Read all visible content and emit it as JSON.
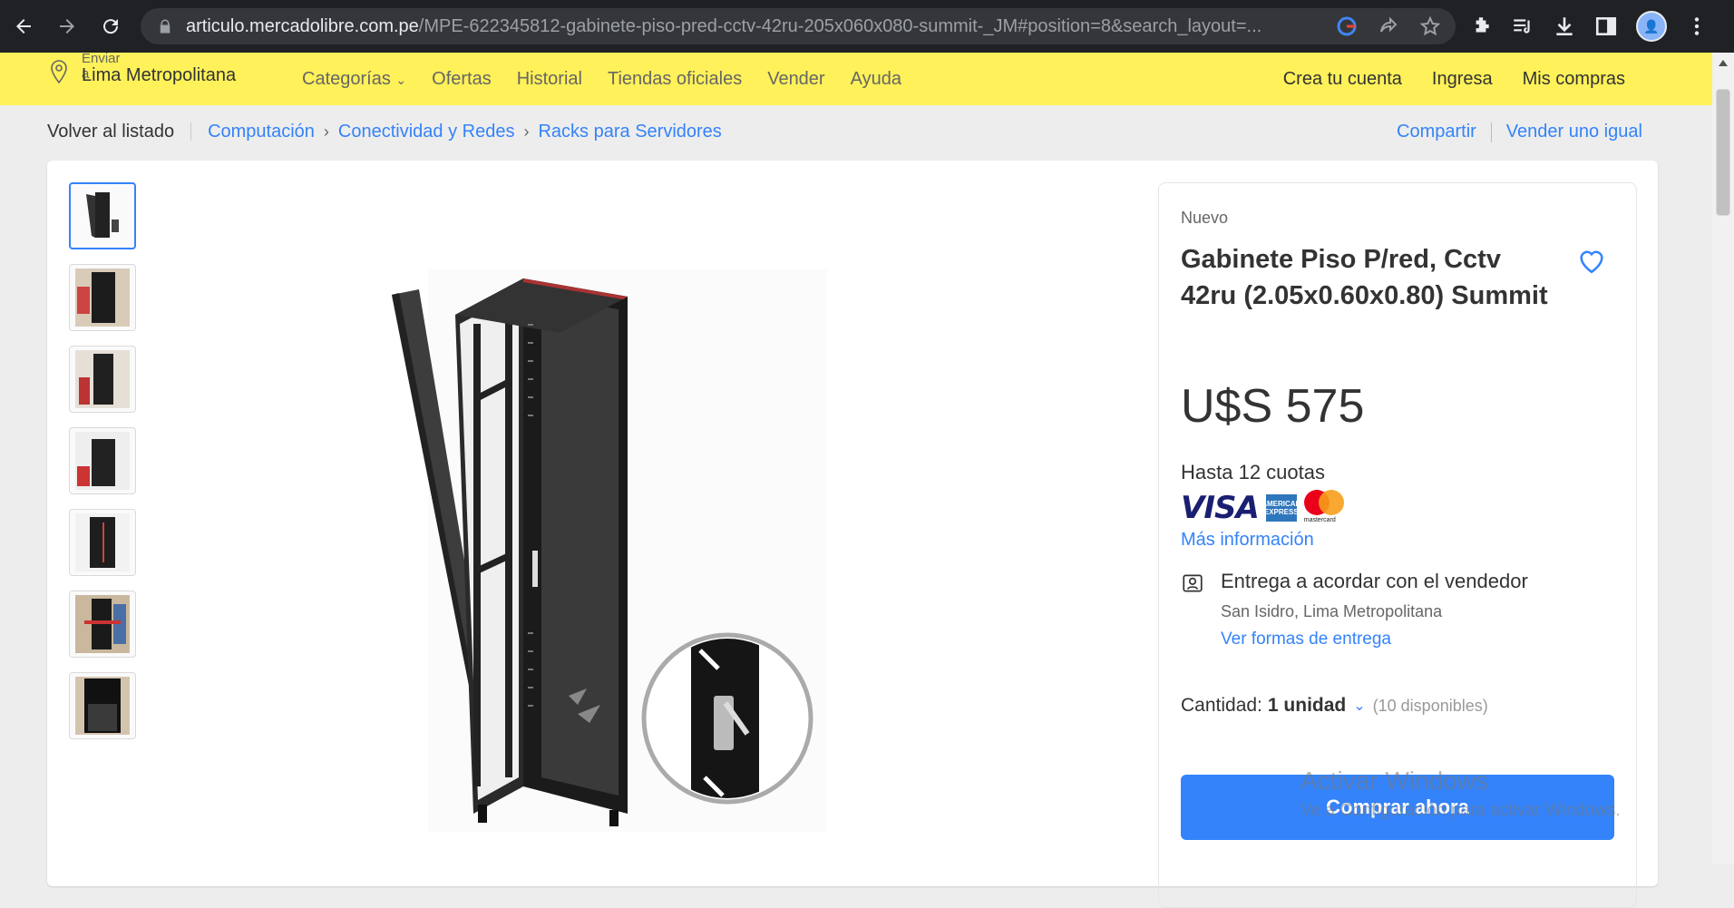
{
  "browser": {
    "url_host": "articulo.mercadolibre.com.pe",
    "url_path": "/MPE-622345812-gabinete-piso-pred-cctv-42ru-205x060x080-summit-_JM#position=8&search_layout=..."
  },
  "header": {
    "location_small": "Enviar a",
    "location_big": "Lima Metropolitana",
    "nav": [
      "Categorías",
      "Ofertas",
      "Historial",
      "Tiendas oficiales",
      "Vender",
      "Ayuda"
    ],
    "user_nav": [
      "Crea tu cuenta",
      "Ingresa",
      "Mis compras"
    ]
  },
  "breadcrumb": {
    "back": "Volver al listado",
    "items": [
      "Computación",
      "Conectividad y Redes",
      "Racks para Servidores"
    ],
    "share": "Compartir",
    "sell_same": "Vender uno igual"
  },
  "product": {
    "condition": "Nuevo",
    "title": "Gabinete Piso P/red, Cctv 42ru (2.05x0.60x0.80) Summit",
    "price": "U$S 575",
    "installments": "Hasta 12 cuotas",
    "payment_brands": [
      "VISA",
      "AMERICAN EXPRESS",
      "mastercard"
    ],
    "more_info": "Más información",
    "delivery_title": "Entrega a acordar con el vendedor",
    "delivery_location": "San Isidro, Lima Metropolitana",
    "delivery_link": "Ver formas de entrega",
    "quantity_label": "Cantidad:",
    "quantity_value": "1 unidad",
    "quantity_available": "(10 disponibles)",
    "buy_button": "Comprar ahora"
  },
  "watermark": {
    "line1": "Activar Windows",
    "line2": "Ve a Configuración para activar Windows."
  },
  "colors": {
    "header_yellow": "#fff159",
    "accent_blue": "#3483fa",
    "chrome_dark": "#202124"
  }
}
